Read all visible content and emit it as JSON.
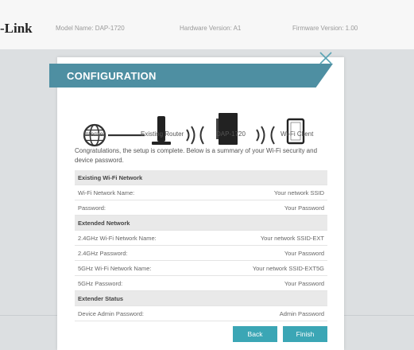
{
  "header": {
    "brand": "-Link",
    "model": "Model Name: DAP-1720",
    "hardware": "Hardware Version: A1",
    "firmware": "Firmware Version: 1.00"
  },
  "modal": {
    "title": "CONFIGURATION",
    "diagram": {
      "internet": "Internet",
      "router": "Existing Router",
      "extender": "DAP-1720",
      "client": "Wi-Fi Client"
    },
    "intro": "Congratulations, the setup is complete. Below is a summary of your Wi-Fi security and device password.",
    "summary": {
      "existing": {
        "heading": "Existing Wi-Fi Network",
        "rows": [
          {
            "label": "Wi-Fi Network Name:",
            "value": "Your network SSID"
          },
          {
            "label": "Password:",
            "value": "Your Password"
          }
        ]
      },
      "extended": {
        "heading": "Extended Network",
        "rows": [
          {
            "label": "2.4GHz Wi-Fi Network Name:",
            "value": "Your network SSID-EXT"
          },
          {
            "label": "2.4GHz Password:",
            "value": "Your Password"
          },
          {
            "label": "5GHz Wi-Fi Network Name:",
            "value": "Your network SSID-EXT5G"
          },
          {
            "label": "5GHz Password:",
            "value": "Your Password"
          }
        ]
      },
      "status": {
        "heading": "Extender Status",
        "rows": [
          {
            "label": "Device Admin Password:",
            "value": "Admin Password"
          }
        ]
      }
    },
    "buttons": {
      "back": "Back",
      "finish": "Finish"
    }
  },
  "icons": {
    "close": "close-icon",
    "internet": "globe-icon",
    "router": "router-icon",
    "extender": "extender-icon",
    "client": "tablet-icon",
    "signal": "wifi-signal-icon"
  },
  "colors": {
    "accent": "#4e8fa2",
    "button": "#3ba6b5",
    "section_bg": "#e9e9e9"
  }
}
